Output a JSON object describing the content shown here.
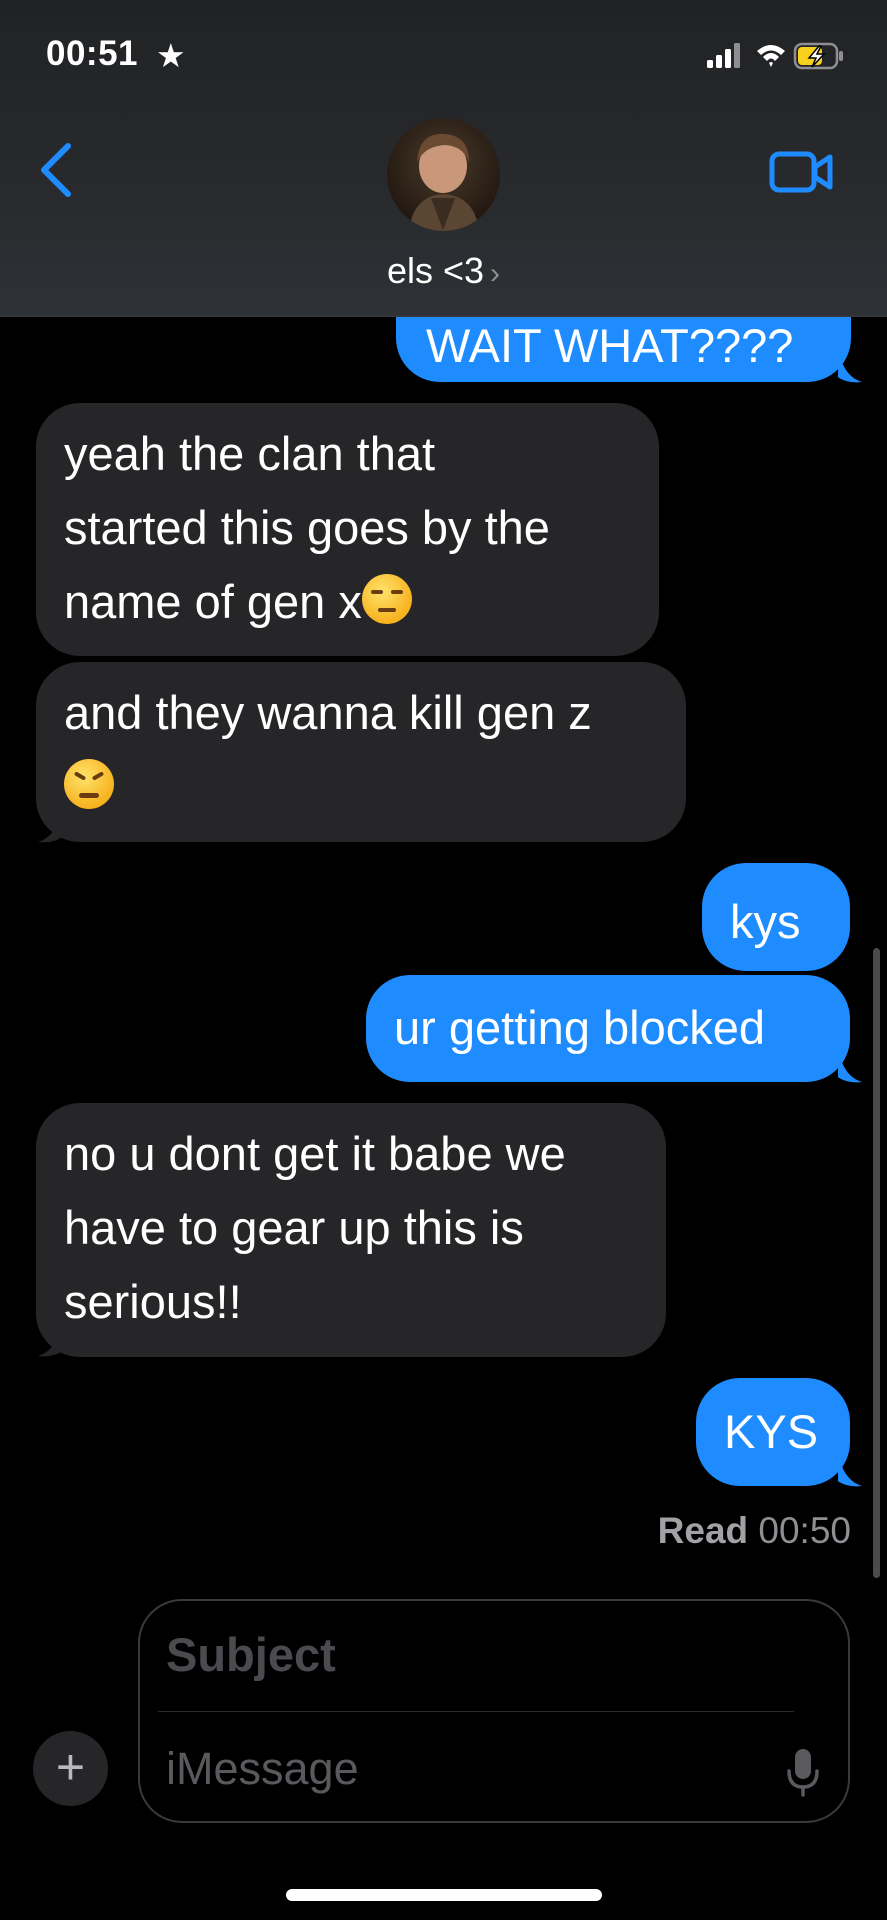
{
  "status_bar": {
    "time": "00:51",
    "star": "★"
  },
  "header": {
    "contact_name": "els <3",
    "chevron": "›",
    "back_icon": "chevron-left-icon",
    "video_icon": "video-camera-icon",
    "accent": "#1e8cff"
  },
  "messages": [
    {
      "side": "out",
      "text": "WAIT WHAT????"
    },
    {
      "side": "in",
      "lines": [
        "yeah the clan that",
        "started this goes by the",
        "name of gen x"
      ],
      "emoji": "unamused-face"
    },
    {
      "side": "in",
      "lines": [
        "and they wanna kill gen z"
      ],
      "emoji": "persevering-face"
    },
    {
      "side": "out",
      "text": "kys"
    },
    {
      "side": "out",
      "text": "ur getting blocked"
    },
    {
      "side": "in",
      "lines": [
        "no u dont get it babe we",
        "have to gear up this is",
        "serious!!"
      ]
    },
    {
      "side": "out",
      "text": "KYS"
    }
  ],
  "read_receipt": {
    "label": "Read",
    "time": "00:50"
  },
  "compose": {
    "plus": "+",
    "subject_placeholder": "Subject",
    "message_placeholder": "iMessage",
    "mic_icon": "microphone-icon"
  },
  "colors": {
    "outgoing": "#1e8cff",
    "incoming": "#262628",
    "background": "#000000"
  }
}
